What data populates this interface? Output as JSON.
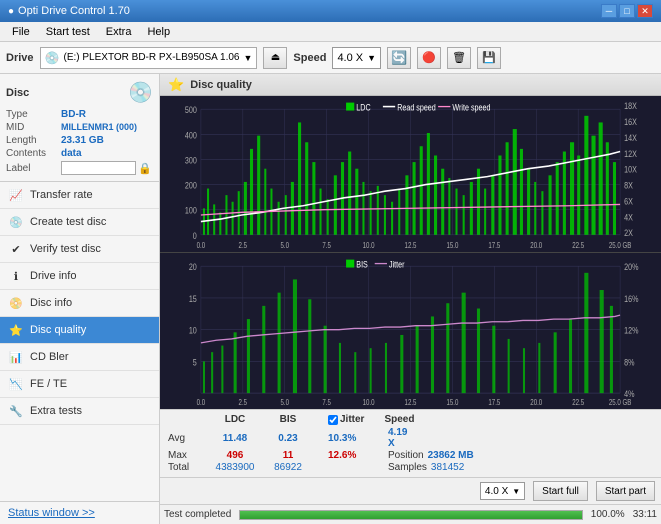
{
  "app": {
    "title": "Opti Drive Control 1.70",
    "logo": "●"
  },
  "titlebar": {
    "minimize": "─",
    "maximize": "□",
    "close": "✕"
  },
  "menubar": {
    "items": [
      "File",
      "Start test",
      "Extra",
      "Help"
    ]
  },
  "toolbar": {
    "drive_label": "Drive",
    "drive_name": "(E:) PLEXTOR BD-R  PX-LB950SA 1.06",
    "speed_label": "Speed",
    "speed_value": "4.0 X"
  },
  "disc": {
    "title": "Disc",
    "type_label": "Type",
    "type_value": "BD-R",
    "mid_label": "MID",
    "mid_value": "MILLENMR1 (000)",
    "length_label": "Length",
    "length_value": "23.31 GB",
    "contents_label": "Contents",
    "contents_value": "data",
    "label_label": "Label"
  },
  "nav": {
    "items": [
      {
        "id": "transfer-rate",
        "label": "Transfer rate",
        "icon": "📈"
      },
      {
        "id": "create-test-disc",
        "label": "Create test disc",
        "icon": "💿"
      },
      {
        "id": "verify-test-disc",
        "label": "Verify test disc",
        "icon": "✔"
      },
      {
        "id": "drive-info",
        "label": "Drive info",
        "icon": "ℹ"
      },
      {
        "id": "disc-info",
        "label": "Disc info",
        "icon": "📀"
      },
      {
        "id": "disc-quality",
        "label": "Disc quality",
        "icon": "⭐",
        "active": true
      },
      {
        "id": "cd-bler",
        "label": "CD Bler",
        "icon": "📊"
      },
      {
        "id": "fe-te",
        "label": "FE / TE",
        "icon": "📉"
      },
      {
        "id": "extra-tests",
        "label": "Extra tests",
        "icon": "🔧"
      }
    ],
    "status_window": "Status window >>"
  },
  "chart": {
    "title": "Disc quality",
    "top": {
      "legend": [
        "LDC",
        "Read speed",
        "Write speed"
      ],
      "y_max": 500,
      "y_labels_left": [
        "500",
        "400",
        "300",
        "200",
        "100",
        "0"
      ],
      "y_labels_right": [
        "18X",
        "16X",
        "14X",
        "12X",
        "10X",
        "8X",
        "6X",
        "4X",
        "2X"
      ],
      "x_labels": [
        "0.0",
        "2.5",
        "5.0",
        "7.5",
        "10.0",
        "12.5",
        "15.0",
        "17.5",
        "20.0",
        "22.5",
        "25.0 GB"
      ]
    },
    "bottom": {
      "legend": [
        "BIS",
        "Jitter"
      ],
      "y_max": 20,
      "y_labels_left": [
        "20",
        "15",
        "10",
        "5"
      ],
      "y_labels_right": [
        "20%",
        "16%",
        "12%",
        "8%",
        "4%"
      ],
      "x_labels": [
        "0.0",
        "2.5",
        "5.0",
        "7.5",
        "10.0",
        "12.5",
        "15.0",
        "17.5",
        "20.0",
        "22.5",
        "25.0 GB"
      ]
    }
  },
  "stats": {
    "columns": [
      "LDC",
      "BIS",
      "",
      "Jitter",
      "Speed",
      ""
    ],
    "avg_label": "Avg",
    "avg_ldc": "11.48",
    "avg_bis": "0.23",
    "avg_jitter": "10.3%",
    "avg_speed": "4.19 X",
    "max_label": "Max",
    "max_ldc": "496",
    "max_bis": "11",
    "max_jitter": "12.6%",
    "position_label": "Position",
    "position_val": "23862 MB",
    "total_label": "Total",
    "total_ldc": "4383900",
    "total_bis": "86922",
    "samples_label": "Samples",
    "samples_val": "381452",
    "speed_select": "4.0 X",
    "jitter_checked": true,
    "jitter_label": "Jitter",
    "start_full_label": "Start full",
    "start_part_label": "Start part"
  },
  "statusbar": {
    "text": "Test completed",
    "progress": 100,
    "percent": "100.0%",
    "time": "33:11"
  }
}
